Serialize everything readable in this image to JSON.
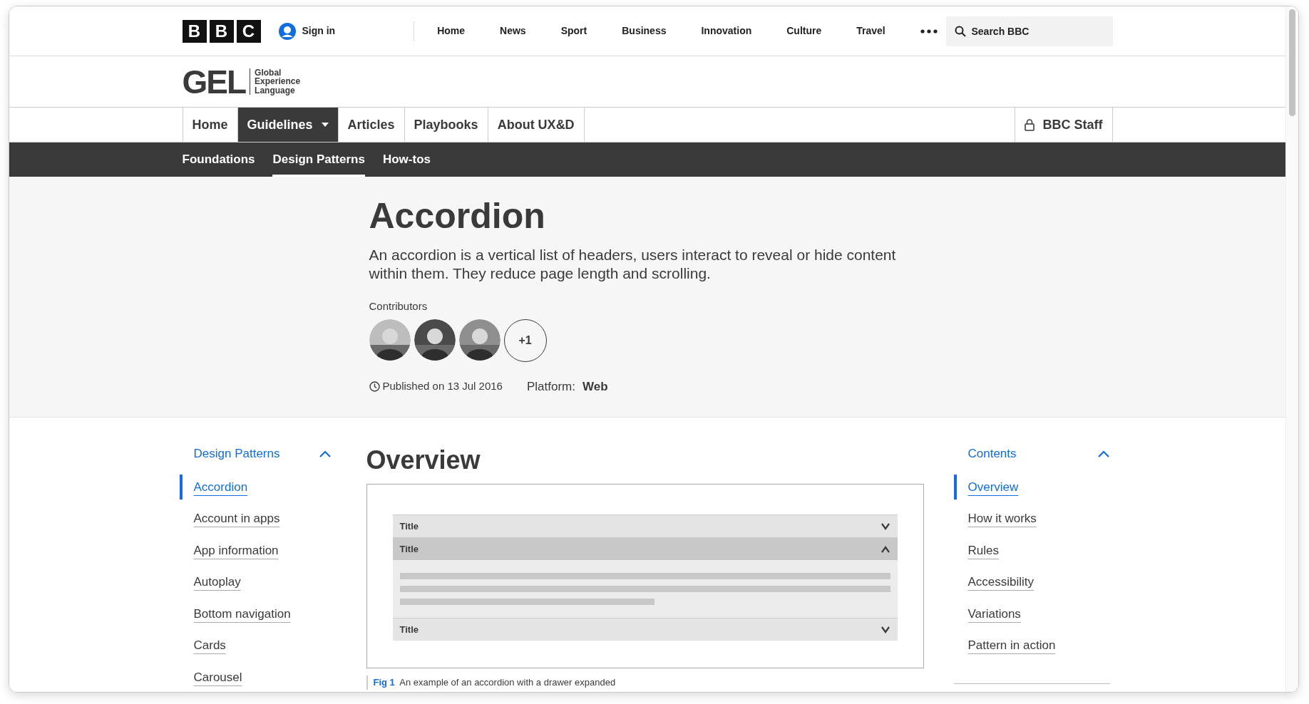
{
  "global_nav": {
    "logo_letters": [
      "B",
      "B",
      "C"
    ],
    "sign_in": "Sign in",
    "links": [
      "Home",
      "News",
      "Sport",
      "Business",
      "Innovation",
      "Culture",
      "Travel"
    ],
    "search": {
      "placeholder": "Search BBC"
    }
  },
  "site_header": {
    "logo": "GEL",
    "tagline": [
      "Global",
      "Experience",
      "Language"
    ]
  },
  "main_nav": {
    "tabs": [
      {
        "label": "Home",
        "selected": false,
        "dropdown": false
      },
      {
        "label": "Guidelines",
        "selected": true,
        "dropdown": true
      },
      {
        "label": "Articles",
        "selected": false,
        "dropdown": false
      },
      {
        "label": "Playbooks",
        "selected": false,
        "dropdown": false
      },
      {
        "label": "About UX&D",
        "selected": false,
        "dropdown": false
      }
    ],
    "staff_link": "BBC Staff"
  },
  "sub_nav": [
    {
      "label": "Foundations",
      "selected": false
    },
    {
      "label": "Design Patterns",
      "selected": true
    },
    {
      "label": "How-tos",
      "selected": false
    }
  ],
  "hero": {
    "title": "Accordion",
    "description": "An accordion is a vertical list of headers, users interact to reveal or hide content within them. They reduce page length and scrolling.",
    "contributors_label": "Contributors",
    "contributors": [
      {
        "kind": "picture"
      },
      {
        "kind": "picture"
      },
      {
        "kind": "picture"
      },
      {
        "kind": "count",
        "text": "+1"
      }
    ],
    "published": "Published on 13 Jul 2016",
    "platform_label": "Platform:",
    "platform": "Web"
  },
  "sidebar": {
    "heading": "Design Patterns",
    "expanded": true,
    "items": [
      {
        "label": "Accordion",
        "selected": true
      },
      {
        "label": "Account in apps",
        "selected": false
      },
      {
        "label": "App information",
        "selected": false
      },
      {
        "label": "Autoplay",
        "selected": false
      },
      {
        "label": "Bottom navigation",
        "selected": false
      },
      {
        "label": "Cards",
        "selected": false
      },
      {
        "label": "Carousel",
        "selected": false
      }
    ]
  },
  "overview": {
    "heading": "Overview",
    "figure": {
      "rows": [
        {
          "title": "Title",
          "expanded": false
        },
        {
          "title": "Title",
          "expanded": true
        },
        {
          "title": "Title",
          "expanded": false
        }
      ]
    },
    "caption_label": "Fig 1",
    "caption": "An example of an accordion with a drawer expanded"
  },
  "contents": {
    "heading": "Contents",
    "expanded": true,
    "items": [
      {
        "label": "Overview",
        "selected": true
      },
      {
        "label": "How it works",
        "selected": false
      },
      {
        "label": "Rules",
        "selected": false
      },
      {
        "label": "Accessibility",
        "selected": false
      },
      {
        "label": "Variations",
        "selected": false
      },
      {
        "label": "Pattern in action",
        "selected": false
      }
    ]
  }
}
